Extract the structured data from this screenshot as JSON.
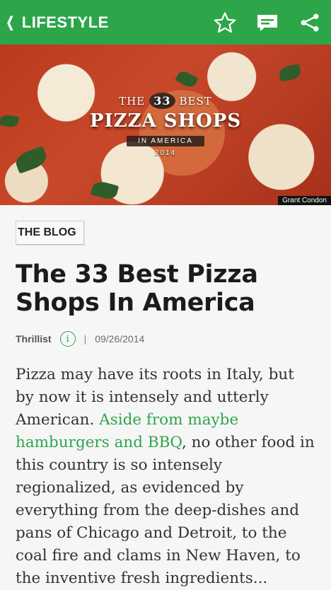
{
  "header": {
    "back_label": "LIFESTYLE",
    "bg_color": "#2da64a"
  },
  "hero": {
    "line1_prefix": "THE",
    "line1_number": "33",
    "line1_suffix": "BEST",
    "line2": "PIZZA SHOPS",
    "line3": "IN AMERICA",
    "line4": "2014",
    "credit": "Grant Condon"
  },
  "article": {
    "section_tag": "THE BLOG",
    "title": "The 33 Best Pizza Shops In America",
    "author": "Thrillist",
    "separator": "|",
    "date": "09/26/2014",
    "body_part1": "Pizza may have its roots in Italy, but by now it is intensely and utterly American. ",
    "body_link": "Aside from maybe hamburgers and BBQ",
    "body_part2": ", no other food in this country is so intensely regionalized, as evidenced by everything from the deep-dishes and pans of Chicago and Detroit, to the coal fire and clams in New Haven, to the inventive fresh ingredients..."
  }
}
